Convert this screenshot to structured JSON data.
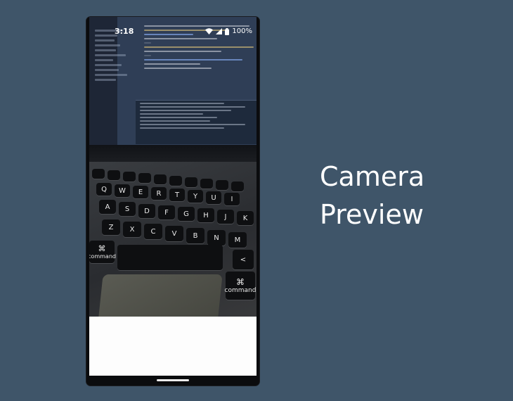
{
  "status_bar": {
    "time": "3:18",
    "battery": "100%",
    "icons": [
      "wifi-icon",
      "signal-icon",
      "battery-icon"
    ]
  },
  "heading": {
    "line1": "Camera",
    "line2": "Preview"
  },
  "keyboard": {
    "row_q": [
      "Q",
      "W",
      "E",
      "R",
      "T",
      "Y",
      "U",
      "I"
    ],
    "row_a": [
      "A",
      "S",
      "D",
      "F",
      "G",
      "H",
      "J",
      "K"
    ],
    "row_z": [
      "Z",
      "X",
      "C",
      "V",
      "B",
      "N",
      "M",
      "<"
    ],
    "command_left": "command",
    "command_right": "command",
    "command_symbol": "⌘"
  },
  "colors": {
    "background": "#3f5569",
    "heading": "#ffffff"
  }
}
